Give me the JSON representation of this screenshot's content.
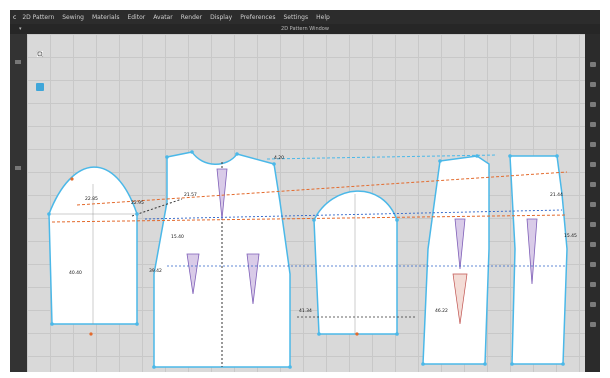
{
  "menu": {
    "logo": "c",
    "items": [
      "2D Pattern",
      "Sewing",
      "Materials",
      "Editor",
      "Avatar",
      "Render",
      "Display",
      "Preferences",
      "Settings",
      "Help"
    ]
  },
  "window": {
    "title": "2D Pattern Window"
  },
  "tools": [
    {
      "icon": "transform-pattern-icon",
      "active": false
    },
    {
      "icon": "edit-point-icon",
      "active": false
    },
    {
      "icon": "edit-curvature-icon",
      "active": false
    },
    {
      "icon": "segment-tape-icon",
      "active": true
    },
    {
      "icon": "zoom-icon",
      "active": false
    }
  ],
  "measurements": {
    "sleeve_cap_left": "22.85",
    "sleeve_cap_right": "22.95",
    "sleeve_length": "40.40",
    "sleeve_side": "39.42",
    "front_neck": "4.20",
    "front_shoulder": "21.57",
    "front_armhole": "15.40",
    "front_side": "41.34",
    "back_panel_length": "46.22",
    "back_shoulder": "21.44",
    "back_armhole": "15.45"
  },
  "colors": {
    "accent": "#3fa6d9",
    "pattern_fill": "#ffffff",
    "outline": "#4bb8e8",
    "dart": "#7f5fb8",
    "guideline_orange": "#e36a2c",
    "guideline_blue": "#2e63c7"
  }
}
